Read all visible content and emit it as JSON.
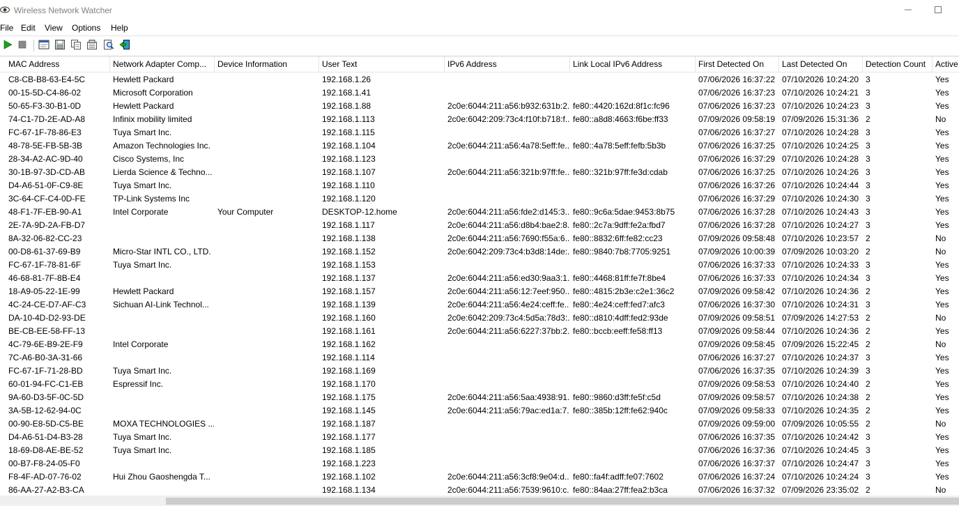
{
  "window": {
    "title": "Wireless Network Watcher",
    "minimize_icon": "minimize-icon",
    "maximize_icon": "maximize-icon"
  },
  "menu": [
    "File",
    "Edit",
    "View",
    "Options",
    "Help"
  ],
  "toolbar": {
    "buttons": [
      {
        "name": "start-scan-button",
        "icon": "play-icon",
        "color": "#1aa31a"
      },
      {
        "name": "stop-scan-button",
        "icon": "stop-icon",
        "color": "#7a7a7a"
      },
      {
        "name": "html-report-button",
        "icon": "window-icon"
      },
      {
        "name": "save-button",
        "icon": "floppy-icon"
      },
      {
        "name": "copy-button",
        "icon": "copy-icon"
      },
      {
        "name": "properties-button",
        "icon": "properties-icon"
      },
      {
        "name": "find-button",
        "icon": "find-icon"
      },
      {
        "name": "exit-button",
        "icon": "exit-icon"
      }
    ]
  },
  "columns": [
    "MAC Address",
    "Network Adapter Comp...",
    "Device Information",
    "User Text",
    "IPv6 Address",
    "Link Local IPv6 Address",
    "First Detected On",
    "Last Detected On",
    "Detection Count",
    "Active"
  ],
  "rows": [
    [
      "C8-CB-B8-63-E4-5C",
      "Hewlett Packard",
      "",
      "192.168.1.26",
      "",
      "",
      "07/06/2026 16:37:22",
      "07/10/2026 10:24:20",
      "3",
      "Yes"
    ],
    [
      "00-15-5D-C4-86-02",
      "Microsoft Corporation",
      "",
      "192.168.1.41",
      "",
      "",
      "07/06/2026 16:37:23",
      "07/10/2026 10:24:21",
      "3",
      "Yes"
    ],
    [
      "50-65-F3-30-B1-0D",
      "Hewlett Packard",
      "",
      "192.168.1.88",
      "2c0e:6044:211:a56:b932:631b:2...",
      "fe80::4420:162d:8f1c:fc96",
      "07/06/2026 16:37:23",
      "07/10/2026 10:24:23",
      "3",
      "Yes"
    ],
    [
      "74-C1-7D-2E-AD-A8",
      "Infinix mobility limited",
      "",
      "192.168.1.113",
      "2c0e:6042:209:73c4:f10f:b718:f...",
      "fe80::a8d8:4663:f6be:ff33",
      "07/09/2026 09:58:19",
      "07/09/2026 15:31:36",
      "2",
      "No"
    ],
    [
      "FC-67-1F-78-86-E3",
      "Tuya Smart Inc.",
      "",
      "192.168.1.115",
      "",
      "",
      "07/06/2026 16:37:27",
      "07/10/2026 10:24:28",
      "3",
      "Yes"
    ],
    [
      "48-78-5E-FB-5B-3B",
      "Amazon Technologies Inc.",
      "",
      "192.168.1.104",
      "2c0e:6044:211:a56:4a78:5eff:fe...",
      "fe80::4a78:5eff:fefb:5b3b",
      "07/06/2026 16:37:25",
      "07/10/2026 10:24:25",
      "3",
      "Yes"
    ],
    [
      "28-34-A2-AC-9D-40",
      "Cisco Systems, Inc",
      "",
      "192.168.1.123",
      "",
      "",
      "07/06/2026 16:37:29",
      "07/10/2026 10:24:28",
      "3",
      "Yes"
    ],
    [
      "30-1B-97-3D-CD-AB",
      "Lierda Science & Techno...",
      "",
      "192.168.1.107",
      "2c0e:6044:211:a56:321b:97ff:fe...",
      "fe80::321b:97ff:fe3d:cdab",
      "07/06/2026 16:37:25",
      "07/10/2026 10:24:26",
      "3",
      "Yes"
    ],
    [
      "D4-A6-51-0F-C9-8E",
      "Tuya Smart Inc.",
      "",
      "192.168.1.110",
      "",
      "",
      "07/06/2026 16:37:26",
      "07/10/2026 10:24:44",
      "3",
      "Yes"
    ],
    [
      "3C-64-CF-C4-0D-FE",
      "TP-Link Systems Inc",
      "",
      "192.168.1.120",
      "",
      "",
      "07/06/2026 16:37:29",
      "07/10/2026 10:24:30",
      "3",
      "Yes"
    ],
    [
      "48-F1-7F-EB-90-A1",
      "Intel Corporate",
      "Your Computer",
      "DESKTOP-12.home",
      "2c0e:6044:211:a56:fde2:d145:3...",
      "fe80::9c6a:5dae:9453:8b75",
      "07/06/2026 16:37:28",
      "07/10/2026 10:24:43",
      "3",
      "Yes"
    ],
    [
      "2E-7A-9D-2A-FB-D7",
      "",
      "",
      "192.168.1.117",
      "2c0e:6044:211:a56:d8b4:bae2:8...",
      "fe80::2c7a:9dff:fe2a:fbd7",
      "07/06/2026 16:37:28",
      "07/10/2026 10:24:27",
      "3",
      "Yes"
    ],
    [
      "8A-32-06-82-CC-23",
      "",
      "",
      "192.168.1.138",
      "2c0e:6044:211:a56:7690:f55a:6...",
      "fe80::8832:6ff:fe82:cc23",
      "07/09/2026 09:58:48",
      "07/10/2026 10:23:57",
      "2",
      "No"
    ],
    [
      "00-D8-61-37-69-B9",
      "Micro-Star INTL CO., LTD.",
      "",
      "192.168.1.152",
      "2c0e:6042:209:73c4:b3d8:14de:...",
      "fe80::9840:7b8:7705:9251",
      "07/09/2026 10:00:39",
      "07/09/2026 10:03:20",
      "2",
      "No"
    ],
    [
      "FC-67-1F-78-81-6F",
      "Tuya Smart Inc.",
      "",
      "192.168.1.153",
      "",
      "",
      "07/06/2026 16:37:33",
      "07/10/2026 10:24:33",
      "3",
      "Yes"
    ],
    [
      "46-68-81-7F-8B-E4",
      "",
      "",
      "192.168.1.137",
      "2c0e:6044:211:a56:ed30:9aa3:1...",
      "fe80::4468:81ff:fe7f:8be4",
      "07/06/2026 16:37:33",
      "07/10/2026 10:24:34",
      "3",
      "Yes"
    ],
    [
      "18-A9-05-22-1E-99",
      "Hewlett Packard",
      "",
      "192.168.1.157",
      "2c0e:6044:211:a56:12:7eef:950...",
      "fe80::4815:2b3e:c2e1:36c2",
      "07/09/2026 09:58:42",
      "07/10/2026 10:24:36",
      "2",
      "Yes"
    ],
    [
      "4C-24-CE-D7-AF-C3",
      "Sichuan AI-Link Technol...",
      "",
      "192.168.1.139",
      "2c0e:6044:211:a56:4e24:ceff:fe...",
      "fe80::4e24:ceff:fed7:afc3",
      "07/06/2026 16:37:30",
      "07/10/2026 10:24:31",
      "3",
      "Yes"
    ],
    [
      "DA-10-4D-D2-93-DE",
      "",
      "",
      "192.168.1.160",
      "2c0e:6042:209:73c4:5d5a:78d3:...",
      "fe80::d810:4dff:fed2:93de",
      "07/09/2026 09:58:51",
      "07/09/2026 14:27:53",
      "2",
      "No"
    ],
    [
      "BE-CB-EE-58-FF-13",
      "",
      "",
      "192.168.1.161",
      "2c0e:6044:211:a56:6227:37bb:2...",
      "fe80::bccb:eeff:fe58:ff13",
      "07/09/2026 09:58:44",
      "07/10/2026 10:24:36",
      "2",
      "Yes"
    ],
    [
      "4C-79-6E-B9-2E-F9",
      "Intel Corporate",
      "",
      "192.168.1.162",
      "",
      "",
      "07/09/2026 09:58:45",
      "07/09/2026 15:22:45",
      "2",
      "No"
    ],
    [
      "7C-A6-B0-3A-31-66",
      "",
      "",
      "192.168.1.114",
      "",
      "",
      "07/06/2026 16:37:27",
      "07/10/2026 10:24:37",
      "3",
      "Yes"
    ],
    [
      "FC-67-1F-71-28-BD",
      "Tuya Smart Inc.",
      "",
      "192.168.1.169",
      "",
      "",
      "07/06/2026 16:37:35",
      "07/10/2026 10:24:39",
      "3",
      "Yes"
    ],
    [
      "60-01-94-FC-C1-EB",
      "Espressif Inc.",
      "",
      "192.168.1.170",
      "",
      "",
      "07/09/2026 09:58:53",
      "07/10/2026 10:24:40",
      "2",
      "Yes"
    ],
    [
      "9A-60-D3-5F-0C-5D",
      "",
      "",
      "192.168.1.175",
      "2c0e:6044:211:a56:5aa:4938:91...",
      "fe80::9860:d3ff:fe5f:c5d",
      "07/09/2026 09:58:57",
      "07/10/2026 10:24:38",
      "2",
      "Yes"
    ],
    [
      "3A-5B-12-62-94-0C",
      "",
      "",
      "192.168.1.145",
      "2c0e:6044:211:a56:79ac:ed1a:7...",
      "fe80::385b:12ff:fe62:940c",
      "07/09/2026 09:58:33",
      "07/10/2026 10:24:35",
      "2",
      "Yes"
    ],
    [
      "00-90-E8-5D-C5-BE",
      "MOXA TECHNOLOGIES ...",
      "",
      "192.168.1.187",
      "",
      "",
      "07/09/2026 09:59:00",
      "07/09/2026 10:05:55",
      "2",
      "No"
    ],
    [
      "D4-A6-51-D4-B3-28",
      "Tuya Smart Inc.",
      "",
      "192.168.1.177",
      "",
      "",
      "07/06/2026 16:37:35",
      "07/10/2026 10:24:42",
      "3",
      "Yes"
    ],
    [
      "18-69-D8-AE-BE-52",
      "Tuya Smart Inc.",
      "",
      "192.168.1.185",
      "",
      "",
      "07/06/2026 16:37:36",
      "07/10/2026 10:24:45",
      "3",
      "Yes"
    ],
    [
      "00-B7-F8-24-05-F0",
      "",
      "",
      "192.168.1.223",
      "",
      "",
      "07/06/2026 16:37:37",
      "07/10/2026 10:24:47",
      "3",
      "Yes"
    ],
    [
      "F8-4F-AD-07-76-02",
      "Hui Zhou Gaoshengda T...",
      "",
      "192.168.1.102",
      "2c0e:6044:211:a56:3cf8:9e04:d...",
      "fe80::fa4f:adff:fe07:7602",
      "07/06/2026 16:37:24",
      "07/10/2026 10:24:24",
      "3",
      "Yes"
    ],
    [
      "86-AA-27-A2-B3-CA",
      "",
      "",
      "192.168.1.134",
      "2c0e:6044:211:a56:7539:9610:c...",
      "fe80::84aa:27ff:fea2:b3ca",
      "07/06/2026 16:37:32",
      "07/09/2026 23:35:02",
      "2",
      "No"
    ]
  ]
}
